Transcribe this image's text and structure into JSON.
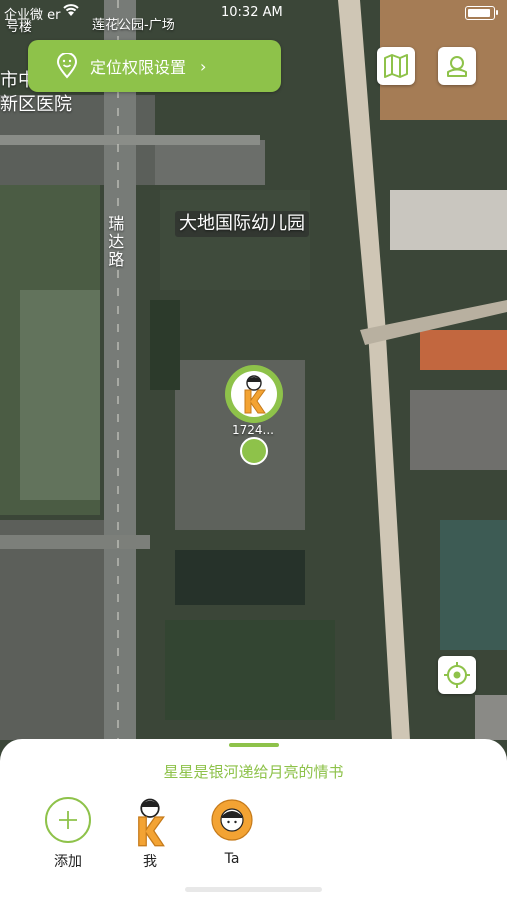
{
  "status_bar": {
    "carrier": "企业微 er",
    "time": "10:32 AM"
  },
  "map": {
    "labels": {
      "hospital_line1": "市中",
      "hospital_line2": "新区医院",
      "building_num": "号楼",
      "top_poi": "莲花公园-广场",
      "kindergarten": "大地国际幼儿园",
      "road": "瑞达路"
    },
    "marker_label": "1724..."
  },
  "permission_banner": {
    "label": "定位权限设置",
    "chevron": "›"
  },
  "icons": {
    "map_button": "map-icon",
    "profile_button": "profile-icon",
    "locate_button": "locate-icon"
  },
  "bottom_sheet": {
    "motto": "星星是银河递给月亮的情书",
    "members": [
      {
        "name": "添加"
      },
      {
        "name": "我"
      },
      {
        "name": "Ta"
      }
    ]
  },
  "colors": {
    "accent": "#8ec24a",
    "sheet_bg": "#ffffff"
  }
}
